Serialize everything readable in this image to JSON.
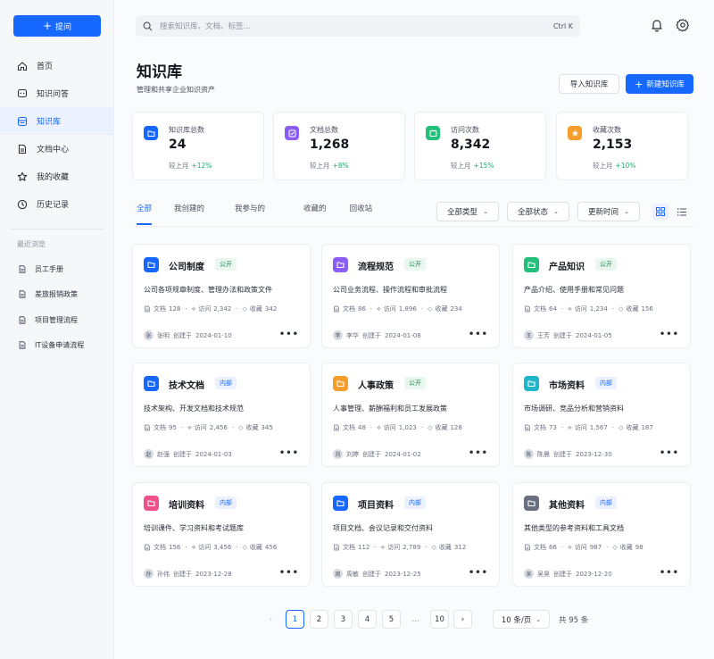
{
  "sidebar": {
    "ask_button": "提问",
    "nav": [
      {
        "label": "首页",
        "icon": "home-icon"
      },
      {
        "label": "知识问答",
        "icon": "chat-icon"
      },
      {
        "label": "知识库",
        "icon": "database-icon",
        "active": true
      },
      {
        "label": "文档中心",
        "icon": "document-icon"
      },
      {
        "label": "我的收藏",
        "icon": "star-icon"
      },
      {
        "label": "历史记录",
        "icon": "clock-icon"
      }
    ],
    "recent_title": "最近浏览",
    "recent": [
      "员工手册",
      "差旅报销政策",
      "项目管理流程",
      "IT设备申请流程"
    ]
  },
  "header": {
    "search_placeholder": "搜索知识库、文档、标签...",
    "search_shortcut": "Ctrl K"
  },
  "page": {
    "title": "知识库",
    "subtitle": "管理和共享企业知识资产",
    "import_button": "导入知识库",
    "new_button": "新建知识库"
  },
  "stats": [
    {
      "label": "知识库总数",
      "value": "24",
      "trend_label": "较上月",
      "trend": "+12%",
      "color": "#1668ff"
    },
    {
      "label": "文档总数",
      "value": "1,268",
      "trend_label": "较上月",
      "trend": "+8%",
      "color": "#8b5cf6"
    },
    {
      "label": "访问次数",
      "value": "8,342",
      "trend_label": "较上月",
      "trend": "+15%",
      "color": "#22c07a"
    },
    {
      "label": "收藏次数",
      "value": "2,153",
      "trend_label": "较上月",
      "trend": "+10%",
      "color": "#f59e2b"
    }
  ],
  "tabs": [
    "全部",
    "我创建的",
    "我参与的",
    "收藏的",
    "回收站"
  ],
  "filters": {
    "type": "全部类型",
    "status": "全部状态",
    "sort": "更新时间"
  },
  "cards": [
    {
      "title": "公司制度",
      "badge": "公开",
      "badge_type": "pub",
      "color": "#1668ff",
      "desc": "公司各项规章制度、管理办法和政策文件",
      "docs_label": "文档",
      "docs": "128",
      "visits_label": "访问",
      "visits": "2,342",
      "favs_label": "收藏",
      "favs": "342",
      "avatar": "张",
      "author": "张明",
      "created_label": "创建于",
      "date": "2024-01-10"
    },
    {
      "title": "流程规范",
      "badge": "公开",
      "badge_type": "pub",
      "color": "#8b5cf6",
      "desc": "公司业务流程、操作流程和审批流程",
      "docs_label": "文档",
      "docs": "86",
      "visits_label": "访问",
      "visits": "1,896",
      "favs_label": "收藏",
      "favs": "234",
      "avatar": "李",
      "author": "李华",
      "created_label": "创建于",
      "date": "2024-01-08"
    },
    {
      "title": "产品知识",
      "badge": "公开",
      "badge_type": "pub",
      "color": "#22c07a",
      "desc": "产品介绍、使用手册和常见问题",
      "docs_label": "文档",
      "docs": "64",
      "visits_label": "访问",
      "visits": "1,234",
      "favs_label": "收藏",
      "favs": "156",
      "avatar": "王",
      "author": "王芳",
      "created_label": "创建于",
      "date": "2024-01-05"
    },
    {
      "title": "技术文档",
      "badge": "内部",
      "badge_type": "int",
      "color": "#1668ff",
      "desc": "技术架构、开发文档和技术规范",
      "docs_label": "文档",
      "docs": "95",
      "visits_label": "访问",
      "visits": "2,456",
      "favs_label": "收藏",
      "favs": "345",
      "avatar": "赵",
      "author": "赵强",
      "created_label": "创建于",
      "date": "2024-01-03"
    },
    {
      "title": "人事政策",
      "badge": "公开",
      "badge_type": "pub",
      "color": "#f59e2b",
      "desc": "人事管理、薪酬福利和员工发展政策",
      "docs_label": "文档",
      "docs": "48",
      "visits_label": "访问",
      "visits": "1,023",
      "favs_label": "收藏",
      "favs": "128",
      "avatar": "刘",
      "author": "刘婷",
      "created_label": "创建于",
      "date": "2024-01-02"
    },
    {
      "title": "市场资料",
      "badge": "内部",
      "badge_type": "int",
      "color": "#20b5c8",
      "desc": "市场调研、竞品分析和营销资料",
      "docs_label": "文档",
      "docs": "73",
      "visits_label": "访问",
      "visits": "1,567",
      "favs_label": "收藏",
      "favs": "187",
      "avatar": "陈",
      "author": "陈晨",
      "created_label": "创建于",
      "date": "2023-12-30"
    },
    {
      "title": "培训资料",
      "badge": "内部",
      "badge_type": "int",
      "color": "#f0508a",
      "desc": "培训课件、学习资料和考试题库",
      "docs_label": "文档",
      "docs": "156",
      "visits_label": "访问",
      "visits": "3,456",
      "favs_label": "收藏",
      "favs": "456",
      "avatar": "孙",
      "author": "孙伟",
      "created_label": "创建于",
      "date": "2023-12-28"
    },
    {
      "title": "项目资料",
      "badge": "内部",
      "badge_type": "int",
      "color": "#1668ff",
      "desc": "项目文档、会议记录和交付资料",
      "docs_label": "文档",
      "docs": "112",
      "visits_label": "访问",
      "visits": "2,789",
      "favs_label": "收藏",
      "favs": "312",
      "avatar": "周",
      "author": "周敏",
      "created_label": "创建于",
      "date": "2023-12-25"
    },
    {
      "title": "其他资料",
      "badge": "内部",
      "badge_type": "int",
      "color": "#6b7080",
      "desc": "其他类型的参考资料和工具文档",
      "docs_label": "文档",
      "docs": "66",
      "visits_label": "访问",
      "visits": "987",
      "favs_label": "收藏",
      "favs": "98",
      "avatar": "吴",
      "author": "吴昊",
      "created_label": "创建于",
      "date": "2023-12-20"
    }
  ],
  "pagination": {
    "pages": [
      "1",
      "2",
      "3",
      "4",
      "5",
      "...",
      "10"
    ],
    "current": "1",
    "page_size": "10 条/页",
    "total": "共 95 条"
  }
}
